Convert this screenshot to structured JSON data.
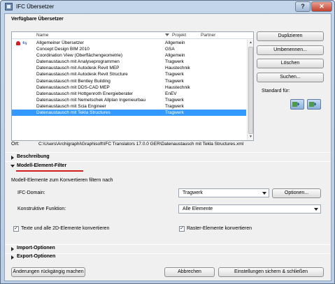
{
  "window": {
    "title": "IFC Übersetzer",
    "help": "?",
    "close": "✕"
  },
  "top_section": {
    "heading": "Verfügbare Übersetzer"
  },
  "list": {
    "columns": {
      "name": "Name",
      "project": "Projekt",
      "partner": "Partner"
    },
    "rows": [
      {
        "name": "Allgemeiner Übersetzer",
        "project": "Allgemein"
      },
      {
        "name": "Concept Design BIM 2010",
        "project": "GSA"
      },
      {
        "name": "Coordination View (Oberflächengeometrie)",
        "project": "Allgemein"
      },
      {
        "name": "Datenaustausch mit Analyseprogrammen",
        "project": "Tragwerk"
      },
      {
        "name": "Datenaustausch mit Autodesk Revit MEP",
        "project": "Haustechnik"
      },
      {
        "name": "Datenaustausch mit Autodesk Revit Structure",
        "project": "Tragwerk"
      },
      {
        "name": "Datenaustausch mit Bentley Building",
        "project": "Tragwerk"
      },
      {
        "name": "Datenaustausch mit DDS-CAD MEP",
        "project": "Haustechnik"
      },
      {
        "name": "Datenaustausch mit Hottgenroth Energieberater",
        "project": "EnEV"
      },
      {
        "name": "Datenaustausch mit Nemetschek Allplan Ingenieurbau",
        "project": "Tragwerk"
      },
      {
        "name": "Datenaustausch mit Scia Engineer",
        "project": "Tragwerk"
      },
      {
        "name": "Datenaustausch mit Tekla Structures",
        "project": "Tragwerk"
      }
    ],
    "selected_index": 11
  },
  "side_buttons": {
    "duplicate": "Duplizieren",
    "rename": "Umbenennen...",
    "delete": "Löschen",
    "search": "Suchen...",
    "standard_label": "Standard für:"
  },
  "ort": {
    "label": "Ort:",
    "path": "C:\\Users\\Archigraphi\\Graphisoft\\IFC Translators 17.0.0 GER\\Datenaustausch mit Tekla Structures.xml"
  },
  "sections": {
    "beschreibung": "Beschreibung",
    "modell_filter": "Modell-Element-Filter",
    "import": "Import-Optionen",
    "export": "Export-Optionen"
  },
  "filter": {
    "intro": "Modell-Elemente zum Konvertieren filtern nach",
    "domain_label": "IFC-Domain:",
    "domain_value": "Tragwerk",
    "options_button": "Optionen...",
    "konstruktive_label": "Konstruktive Funktion:",
    "konstruktive_value": "Alle Elemente",
    "check_texte": "Texte und alle 2D-Elemente konvertieren",
    "check_raster": "Raster-Elemente konvertieren"
  },
  "footer": {
    "undo": "Änderungen rückgängig machen",
    "cancel": "Abbrechen",
    "save_close": "Einstellungen sichern & schließen"
  }
}
